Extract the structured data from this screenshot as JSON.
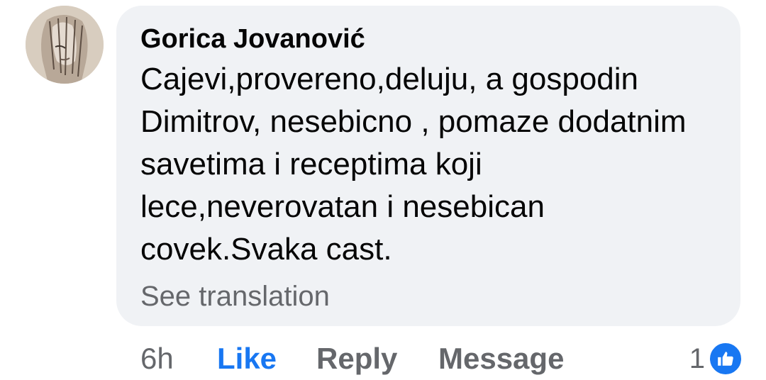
{
  "comment": {
    "author": "Gorica Jovanović",
    "text": "Cajevi,provereno,deluju, a gospodin Dimitrov, nesebicno , pomaze dodatnim savetima i receptima koji lece,neverovatan i nesebican covek.Svaka cast.",
    "see_translation": "See translation"
  },
  "actions": {
    "time": "6h",
    "like": "Like",
    "reply": "Reply",
    "message": "Message"
  },
  "reactions": {
    "count": "1",
    "icon": "thumbs-up-icon"
  },
  "colors": {
    "bubble": "#f0f2f5",
    "accent": "#1877f2",
    "secondary_text": "#65676b"
  }
}
